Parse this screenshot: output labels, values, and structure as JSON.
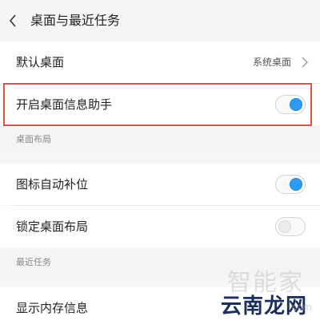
{
  "header": {
    "title": "桌面与最近任务",
    "back_icon": "chevron-left-icon"
  },
  "settings": {
    "default_desktop": {
      "label": "默认桌面",
      "value": "系统桌面"
    },
    "desktop_info_assistant": {
      "label": "开启桌面信息助手",
      "enabled": true
    },
    "section_layout": "桌面布局",
    "auto_fill_icons": {
      "label": "图标自动补位",
      "enabled": true
    },
    "lock_layout": {
      "label": "锁定桌面布局",
      "enabled": false
    },
    "section_recent": "最近任务",
    "show_memory": {
      "label": "显示内存信息"
    }
  },
  "watermark": {
    "top": "智能家",
    "bottom": "云南龙网",
    "suffix": ".com"
  },
  "colors": {
    "accent": "#2b9cf2",
    "highlight_border": "#e0504a"
  }
}
